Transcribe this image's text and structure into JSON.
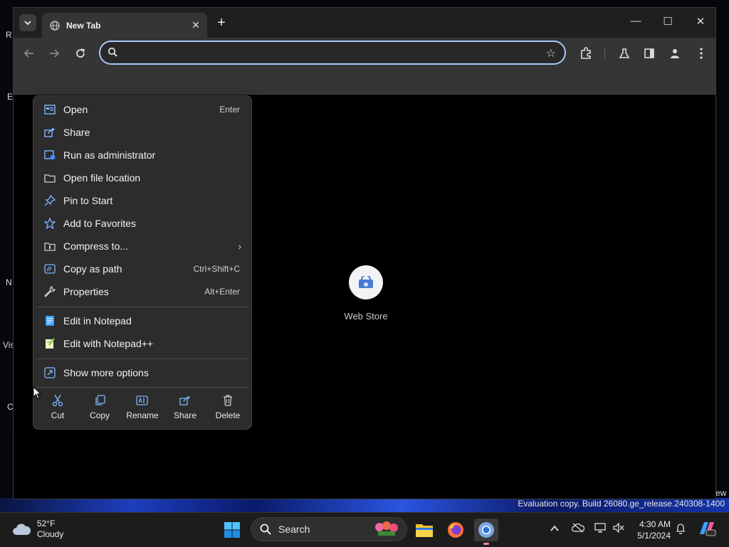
{
  "desktop": {
    "edge_labels": [
      "R",
      "E",
      "N",
      "Vis",
      "C"
    ],
    "edge_label_right": "ew",
    "watermark": "Evaluation copy. Build 26080.ge_release.240308-1400"
  },
  "browser": {
    "tab_title": "New Tab",
    "new_tab_symbol": "+",
    "window_controls": {
      "minimize": "—",
      "maximize": "☐",
      "close": "✕"
    },
    "omnibox_value": "",
    "shortcut_label": "Web Store"
  },
  "context_menu": {
    "items": [
      {
        "label": "Open",
        "shortcut": "Enter",
        "icon": "open-icon"
      },
      {
        "label": "Share",
        "shortcut": "",
        "icon": "share-icon"
      },
      {
        "label": "Run as administrator",
        "shortcut": "",
        "icon": "admin-shield-icon"
      },
      {
        "label": "Open file location",
        "shortcut": "",
        "icon": "folder-icon"
      },
      {
        "label": "Pin to Start",
        "shortcut": "",
        "icon": "pin-icon"
      },
      {
        "label": "Add to Favorites",
        "shortcut": "",
        "icon": "star-icon"
      },
      {
        "label": "Compress to...",
        "shortcut": "",
        "icon": "archive-icon",
        "submenu_arrow": "›"
      },
      {
        "label": "Copy as path",
        "shortcut": "Ctrl+Shift+C",
        "icon": "copy-path-icon"
      },
      {
        "label": "Properties",
        "shortcut": "Alt+Enter",
        "icon": "wrench-icon"
      },
      {
        "label": "Edit in Notepad",
        "shortcut": "",
        "icon": "notepad-icon"
      },
      {
        "label": "Edit with Notepad++",
        "shortcut": "",
        "icon": "notepad-plus-icon"
      },
      {
        "label": "Show more options",
        "shortcut": "",
        "icon": "more-options-icon"
      }
    ],
    "actions": [
      {
        "label": "Cut",
        "icon": "scissors-icon"
      },
      {
        "label": "Copy",
        "icon": "copy-icon"
      },
      {
        "label": "Rename",
        "icon": "rename-icon"
      },
      {
        "label": "Share",
        "icon": "share-icon"
      },
      {
        "label": "Delete",
        "icon": "trash-icon"
      }
    ]
  },
  "taskbar": {
    "weather_temp": "52°F",
    "weather_desc": "Cloudy",
    "search_label": "Search",
    "time": "4:30 AM",
    "date": "5/1/2024"
  },
  "colors": {
    "accent": "#a8c7fa",
    "menu_bg": "#2c2c2c",
    "icon_blue": "#60b0ff"
  }
}
